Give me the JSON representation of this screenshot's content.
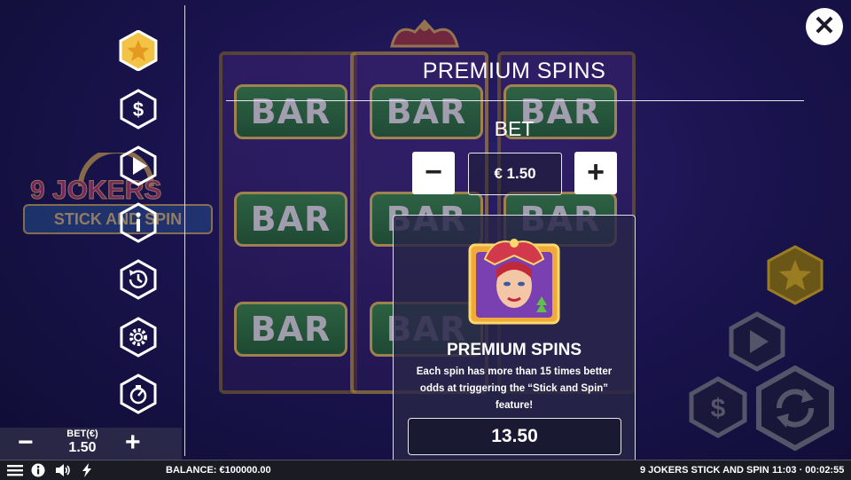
{
  "modal": {
    "title": "PREMIUM SPINS",
    "close_label": "✕",
    "bet_label": "BET",
    "bet_value": "€ 1.50",
    "decrease_label": "−",
    "increase_label": "+"
  },
  "feature_card": {
    "title": "PREMIUM SPINS",
    "description": "Each spin has more than 15 times better odds at triggering the “Stick and Spin” feature!",
    "price": "13.50"
  },
  "background": {
    "logo_line1": "9 JOKERS",
    "logo_line2": "STICK AND SPIN",
    "symbol_text": "BAR"
  },
  "side_menu": [
    {
      "icon": "star-icon"
    },
    {
      "icon": "dollar-icon"
    },
    {
      "icon": "play-icon"
    },
    {
      "icon": "info-icon"
    },
    {
      "icon": "history-icon"
    },
    {
      "icon": "settings-icon"
    },
    {
      "icon": "turbo-icon"
    }
  ],
  "bet_widget": {
    "label": "BET(€)",
    "value": "1.50",
    "minus": "−",
    "plus": "+"
  },
  "footer": {
    "balance": "BALANCE: €100000.00",
    "game_name": "9 JOKERS STICK AND SPIN",
    "time": "11:03 · 00:02:55"
  },
  "colors": {
    "accent_gold": "#f0b93a",
    "background": "#241a63",
    "panel": "#28264a"
  }
}
